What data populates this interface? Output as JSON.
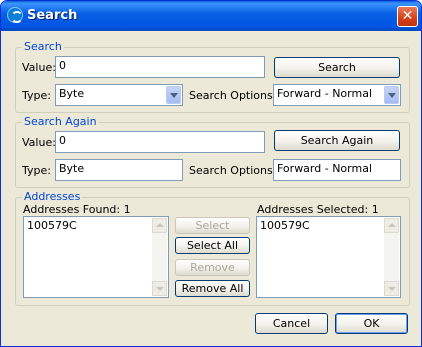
{
  "window": {
    "title": "Search",
    "close_icon": "close-icon"
  },
  "search": {
    "legend": "Search",
    "value_label": "Value:",
    "value": "0",
    "type_label": "Type:",
    "type_value": "Byte",
    "options_label": "Search Options:",
    "options_value": "Forward - Normal",
    "button": "Search"
  },
  "search_again": {
    "legend": "Search Again",
    "value_label": "Value:",
    "value": "0",
    "type_label": "Type:",
    "type_value": "Byte",
    "options_label": "Search Options:",
    "options_value": "Forward - Normal",
    "button": "Search Again"
  },
  "addresses": {
    "legend": "Addresses",
    "found_label": "Addresses Found: 1",
    "found_items": [
      "100579C"
    ],
    "selected_label": "Addresses Selected: 1",
    "selected_items": [
      "100579C"
    ],
    "select_button": "Select",
    "select_all_button": "Select All",
    "remove_button": "Remove",
    "remove_all_button": "Remove All"
  },
  "footer": {
    "cancel": "Cancel",
    "ok": "OK"
  },
  "colors": {
    "accent": "#0046d5",
    "dialog_bg": "#ece9d8",
    "title_bar": "#0054e3"
  }
}
